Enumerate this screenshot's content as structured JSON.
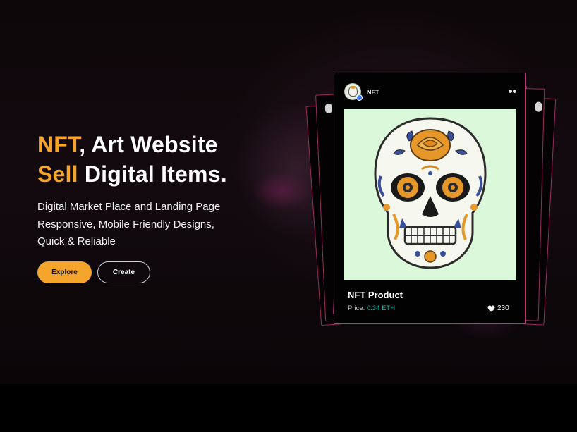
{
  "hero": {
    "title_accent_1": "NFT",
    "title_rest_1": ", Art Website",
    "title_accent_2": "Sell",
    "title_rest_2": " Digital Items.",
    "subtitle_lines": [
      "Digital Market Place and Landing Page",
      "Responsive, Mobile Friendly Designs,",
      "Quick & Reliable"
    ],
    "explore_label": "Explore",
    "create_label": "Create",
    "accent_color": "#f5a52c"
  },
  "card": {
    "creator_name": "NFT",
    "avatar_icon": "skull-avatar",
    "verified_icon": "verified-badge-icon",
    "more_icon": "more-dots-icon",
    "art_icon": "sugar-skull-artwork",
    "product_name": "NFT Product",
    "price_label": "Price:",
    "price_value": "0.34 ETH",
    "likes_icon": "heart-icon",
    "likes_count": "230",
    "border_color": "#c0357a",
    "price_color": "#1fb8a6"
  }
}
